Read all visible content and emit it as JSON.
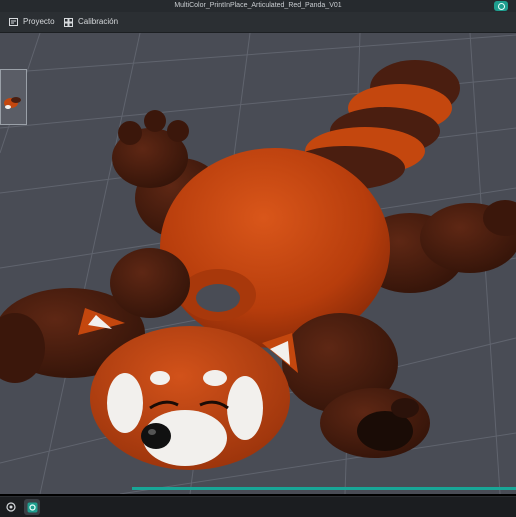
{
  "window": {
    "title": "MultiColor_PrintInPlace_Articulated_Red_Panda_V01",
    "app_icon": "orca-slicer-icon"
  },
  "menu": {
    "items": [
      {
        "label": "Proyecto",
        "icon": "project-icon"
      },
      {
        "label": "Calibración",
        "icon": "calibration-icon"
      }
    ]
  },
  "viewport": {
    "model": "articulated-red-panda",
    "colors": {
      "background": "#494c55",
      "grid": "#60646e",
      "orange": "#c4470e",
      "dark_brown": "#4a1e10",
      "white": "#f2f0ed",
      "black": "#111111"
    }
  },
  "progress": {
    "value": 1.0,
    "color": "#18a697"
  },
  "taskbar": {
    "items": [
      {
        "name": "start-icon"
      },
      {
        "name": "slicer-app-icon"
      }
    ]
  }
}
